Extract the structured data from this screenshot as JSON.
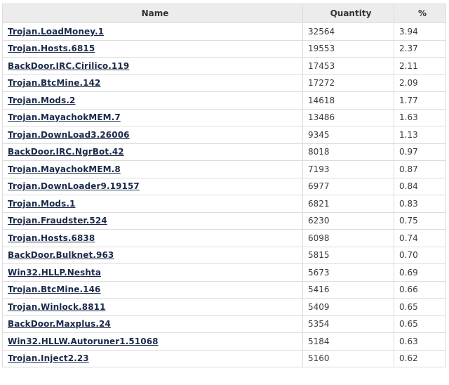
{
  "table": {
    "headers": {
      "name": "Name",
      "quantity": "Quantity",
      "percent": "%"
    },
    "rows": [
      {
        "name": "Trojan.LoadMoney.1",
        "quantity": "32564",
        "percent": "3.94"
      },
      {
        "name": "Trojan.Hosts.6815",
        "quantity": "19553",
        "percent": "2.37"
      },
      {
        "name": "BackDoor.IRC.Cirilico.119",
        "quantity": "17453",
        "percent": "2.11"
      },
      {
        "name": "Trojan.BtcMine.142",
        "quantity": "17272",
        "percent": "2.09"
      },
      {
        "name": "Trojan.Mods.2",
        "quantity": "14618",
        "percent": "1.77"
      },
      {
        "name": "Trojan.MayachokMEM.7",
        "quantity": "13486",
        "percent": "1.63"
      },
      {
        "name": "Trojan.DownLoad3.26006",
        "quantity": "9345",
        "percent": "1.13"
      },
      {
        "name": "BackDoor.IRC.NgrBot.42",
        "quantity": "8018",
        "percent": "0.97"
      },
      {
        "name": "Trojan.MayachokMEM.8",
        "quantity": "7193",
        "percent": "0.87"
      },
      {
        "name": "Trojan.DownLoader9.19157",
        "quantity": "6977",
        "percent": "0.84"
      },
      {
        "name": "Trojan.Mods.1",
        "quantity": "6821",
        "percent": "0.83"
      },
      {
        "name": "Trojan.Fraudster.524",
        "quantity": "6230",
        "percent": "0.75"
      },
      {
        "name": "Trojan.Hosts.6838",
        "quantity": "6098",
        "percent": "0.74"
      },
      {
        "name": "BackDoor.Bulknet.963",
        "quantity": "5815",
        "percent": "0.70"
      },
      {
        "name": "Win32.HLLP.Neshta",
        "quantity": "5673",
        "percent": "0.69"
      },
      {
        "name": "Trojan.BtcMine.146",
        "quantity": "5416",
        "percent": "0.66"
      },
      {
        "name": "Trojan.Winlock.8811",
        "quantity": "5409",
        "percent": "0.65"
      },
      {
        "name": "BackDoor.Maxplus.24",
        "quantity": "5354",
        "percent": "0.65"
      },
      {
        "name": "Win32.HLLW.Autoruner1.51068",
        "quantity": "5184",
        "percent": "0.63"
      },
      {
        "name": "Trojan.Inject2.23",
        "quantity": "5160",
        "percent": "0.62"
      }
    ]
  }
}
